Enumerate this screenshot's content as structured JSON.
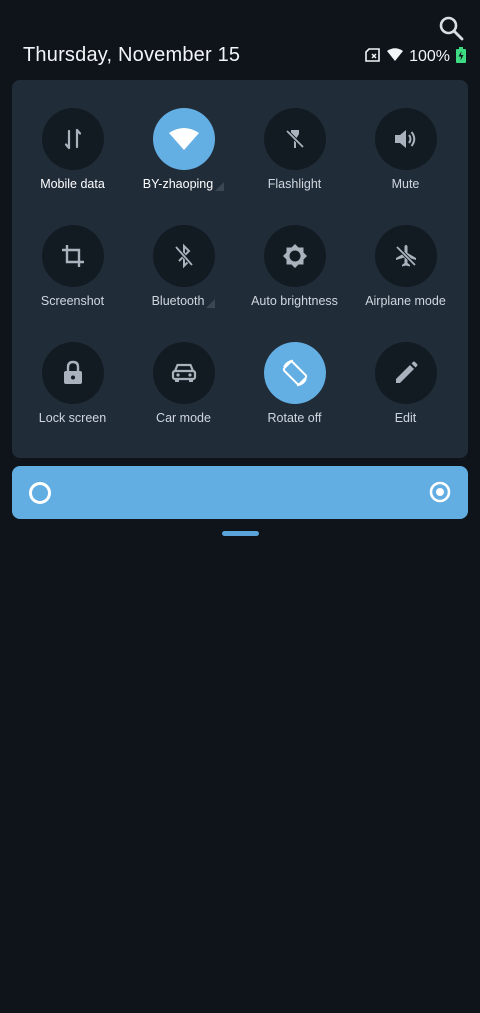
{
  "header": {
    "date": "Thursday, November 15",
    "battery_percent": "100%",
    "search_icon": "search-icon"
  },
  "colors": {
    "background": "#0f141b",
    "panel": "#212c39",
    "tile_off": "#121a22",
    "accent": "#63aee3",
    "battery": "#3ddc84"
  },
  "tiles": [
    {
      "label": "Mobile data",
      "icon": "mobile-data-icon",
      "active": false
    },
    {
      "label": "BY-zhaoping",
      "icon": "wifi-icon",
      "active": true
    },
    {
      "label": "Flashlight",
      "icon": "flashlight-off-icon",
      "active": false
    },
    {
      "label": "Mute",
      "icon": "volume-icon",
      "active": false
    },
    {
      "label": "Screenshot",
      "icon": "crop-icon",
      "active": false
    },
    {
      "label": "Bluetooth",
      "icon": "bluetooth-off-icon",
      "active": false
    },
    {
      "label": "Auto brightness",
      "icon": "brightness-icon",
      "active": false
    },
    {
      "label": "Airplane mode",
      "icon": "airplane-off-icon",
      "active": false
    },
    {
      "label": "Lock screen",
      "icon": "lock-icon",
      "active": false
    },
    {
      "label": "Car mode",
      "icon": "car-icon",
      "active": false
    },
    {
      "label": "Rotate off",
      "icon": "rotate-icon",
      "active": true
    },
    {
      "label": "Edit",
      "icon": "pencil-icon",
      "active": false
    }
  ],
  "brightness": {
    "level": 0,
    "auto_icon": "auto-brightness-icon"
  }
}
